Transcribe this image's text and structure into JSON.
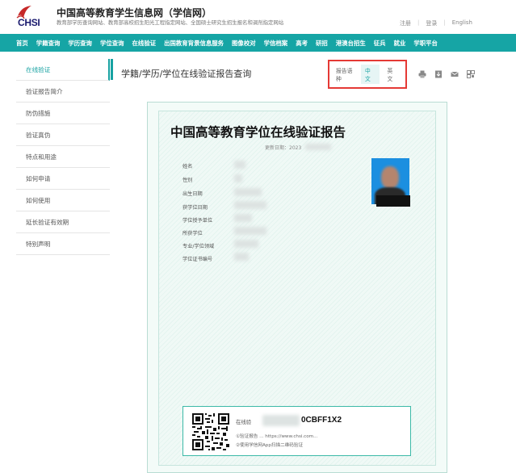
{
  "header": {
    "logo_text": "CHSI",
    "site_title": "中国高等教育学生信息网（学信网）",
    "site_subtitle": "教育部学历查询网站、教育部高校招生阳光工程指定网站、全国硕士研究生招生报名和调剂指定网站",
    "links": [
      "注册",
      "登录",
      "English"
    ]
  },
  "nav": {
    "items": [
      "首页",
      "学籍查询",
      "学历查询",
      "学位查询",
      "在线验证",
      "出国教育背景信息服务",
      "图像校对",
      "学信档案",
      "高考",
      "研招",
      "港澳台招生",
      "征兵",
      "就业",
      "学职平台"
    ]
  },
  "sidebar": {
    "items": [
      "在线验证",
      "验证报告简介",
      "防伪措施",
      "验证真伪",
      "特点和用途",
      "如何申请",
      "如何使用",
      "延长验证有效期",
      "特别声明"
    ]
  },
  "main": {
    "title": "学籍/学历/学位在线验证报告查询"
  },
  "language": {
    "label": "报告语种",
    "options": [
      "中文",
      "英文"
    ],
    "selected": "中文"
  },
  "tools": [
    "print-icon",
    "download-icon",
    "mail-icon",
    "qrcode-icon"
  ],
  "report": {
    "title": "中国高等教育学位在线验证报告",
    "date_label": "更新日期：2023",
    "fields": [
      "姓名",
      "性别",
      "出生日期",
      "获学位日期",
      "学位授予单位",
      "所获学位",
      "专业/学位领域",
      "学位证书编号"
    ]
  },
  "verify": {
    "label": "在线验",
    "code_visible": "0CBFF1X2",
    "line1": "①验证报告 ... https://www.chsi.com...",
    "line2": "②使用学信网App扫描二维码验证"
  },
  "colors": {
    "accent": "#17a2a2",
    "highlight_border": "#e53935"
  }
}
